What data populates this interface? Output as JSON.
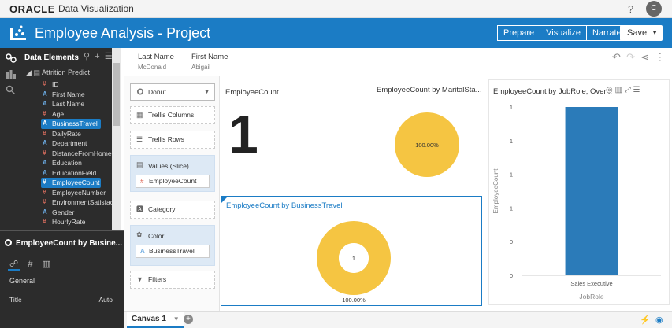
{
  "topbar": {
    "brand": "ORACLE",
    "app_name": "Data Visualization",
    "help": "?",
    "user_initial": "C"
  },
  "header": {
    "title": "Employee Analysis - Project",
    "modes": [
      "Prepare",
      "Visualize",
      "Narrate"
    ],
    "save_label": "Save"
  },
  "data_panel": {
    "title": "Data Elements",
    "dataset": "Attrition Predict",
    "fields": [
      {
        "name": "ID",
        "type": "num",
        "glyph": "#"
      },
      {
        "name": "First Name",
        "type": "attr",
        "glyph": "A"
      },
      {
        "name": "Last Name",
        "type": "attr",
        "glyph": "A"
      },
      {
        "name": "Age",
        "type": "num",
        "glyph": "#"
      },
      {
        "name": "BusinessTravel",
        "type": "attr",
        "glyph": "A",
        "selected": true
      },
      {
        "name": "DailyRate",
        "type": "num",
        "glyph": "#"
      },
      {
        "name": "Department",
        "type": "attr",
        "glyph": "A"
      },
      {
        "name": "DistanceFromHome",
        "type": "num",
        "glyph": "#"
      },
      {
        "name": "Education",
        "type": "attr",
        "glyph": "A"
      },
      {
        "name": "EducationField",
        "type": "attr",
        "glyph": "A"
      },
      {
        "name": "EmployeeCount",
        "type": "num",
        "glyph": "#",
        "selected": true
      },
      {
        "name": "EmployeeNumber",
        "type": "num",
        "glyph": "#"
      },
      {
        "name": "EnvironmentSatisfact",
        "type": "num",
        "glyph": "#"
      },
      {
        "name": "Gender",
        "type": "attr",
        "glyph": "A"
      },
      {
        "name": "HourlyRate",
        "type": "num",
        "glyph": "#"
      }
    ]
  },
  "properties": {
    "title": "EmployeeCount by Busine...",
    "section": "General",
    "row_label": "Title",
    "row_value": "Auto"
  },
  "filter_bar": {
    "filters": [
      {
        "label": "Last Name",
        "value": "McDonald"
      },
      {
        "label": "First Name",
        "value": "Abigail"
      }
    ]
  },
  "grammar": {
    "viz_type": "Donut",
    "trellis_columns": "Trellis Columns",
    "trellis_rows": "Trellis Rows",
    "values_label": "Values (Slice)",
    "values_chip": "EmployeeCount",
    "category_label": "Category",
    "color_label": "Color",
    "color_chip": "BusinessTravel",
    "filters_label": "Filters"
  },
  "canvas": {
    "tile": {
      "title": "EmployeeCount",
      "value": "1"
    },
    "marital_donut": {
      "title": "EmployeeCount by MaritalSta...",
      "pct_label": "100.00%",
      "color": "#f5c542"
    },
    "travel_donut": {
      "title": "EmployeeCount by BusinessTravel",
      "center_label": "1",
      "pct_label": "100.00%",
      "color": "#f5c542"
    },
    "jobrole_bar": {
      "title": "EmployeeCount by JobRole, Over..."
    }
  },
  "chart_data": [
    {
      "type": "pie",
      "title": "EmployeeCount by MaritalSta...",
      "slices": [
        {
          "label": "",
          "value": 100.0,
          "display": "100.00%"
        }
      ]
    },
    {
      "type": "pie",
      "title": "EmployeeCount by BusinessTravel",
      "donut": true,
      "center_label": "1",
      "slices": [
        {
          "label": "",
          "value": 100.0,
          "display": "100.00%"
        }
      ]
    },
    {
      "type": "bar",
      "title": "EmployeeCount by JobRole, Over...",
      "xlabel": "JobRole",
      "ylabel": "EmployeeCount",
      "categories": [
        "Sales Executive"
      ],
      "values": [
        1
      ],
      "ylim": [
        0,
        1
      ],
      "ytick_labels": [
        "1",
        "1",
        "1",
        "1",
        "0",
        "0"
      ],
      "color": "#2b7bb9"
    }
  ],
  "bottom_bar": {
    "canvas_tab": "Canvas 1"
  }
}
